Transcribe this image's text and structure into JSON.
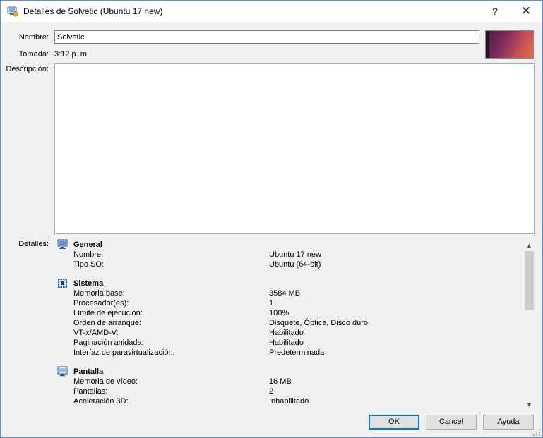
{
  "window": {
    "title": "Detalles de Solvetic (Ubuntu 17 new)",
    "help_symbol": "?",
    "close_symbol": "✕"
  },
  "form": {
    "name_label": "Nombre:",
    "name_value": "Solvetic",
    "taken_label": "Tomada:",
    "taken_value": "3:12 p. m.",
    "description_label": "Descripción:",
    "description_value": "",
    "details_label": "Detalles:"
  },
  "details": {
    "general": {
      "title": "General",
      "icon": "monitor-icon",
      "rows": [
        {
          "key": "Nombre:",
          "value": "Ubuntu 17 new"
        },
        {
          "key": "Tipo SO:",
          "value": "Ubuntu (64-bit)"
        }
      ]
    },
    "system": {
      "title": "Sistema",
      "icon": "chip-icon",
      "rows": [
        {
          "key": "Memoria base:",
          "value": "3584 MB"
        },
        {
          "key": "Procesador(es):",
          "value": "1"
        },
        {
          "key": "Límite de ejecución:",
          "value": "100%"
        },
        {
          "key": "Orden de arranque:",
          "value": "Disquete, Óptica, Disco duro"
        },
        {
          "key": "VT-x/AMD-V:",
          "value": "Habilitado"
        },
        {
          "key": "Paginación anidada:",
          "value": "Habilitado"
        },
        {
          "key": "Interfaz de paravirtualización:",
          "value": "Predeterminada"
        }
      ]
    },
    "display": {
      "title": "Pantalla",
      "icon": "display-icon",
      "rows": [
        {
          "key": "Memoria de vídeo:",
          "value": "16 MB"
        },
        {
          "key": "Pantallas:",
          "value": "2"
        },
        {
          "key": "Aceleración 3D:",
          "value": "Inhabilitado"
        }
      ]
    }
  },
  "buttons": {
    "ok": "OK",
    "cancel": "Cancel",
    "help": "Ayuda"
  },
  "colors": {
    "accent": "#0078d7",
    "dialog_bg": "#f0f0f0",
    "window_border": "#5f8fcf"
  }
}
